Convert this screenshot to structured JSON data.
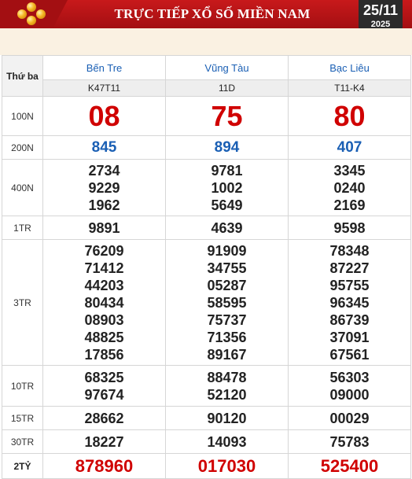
{
  "header": {
    "title": "TRỰC TIẾP XỔ SỐ MIỀN NAM",
    "date_day": "25/11",
    "date_year": "2025",
    "logo_icon": "lottery-balls-icon"
  },
  "table": {
    "weekday": "Thứ ba",
    "provinces": [
      {
        "name": "Bến Tre",
        "code": "K47T11"
      },
      {
        "name": "Vũng Tàu",
        "code": "11D"
      },
      {
        "name": "Bạc Liêu",
        "code": "T11-K4"
      }
    ],
    "prizes": [
      {
        "label": "100N",
        "values": [
          [
            "08"
          ],
          [
            "75"
          ],
          [
            "80"
          ]
        ]
      },
      {
        "label": "200N",
        "values": [
          [
            "845"
          ],
          [
            "894"
          ],
          [
            "407"
          ]
        ]
      },
      {
        "label": "400N",
        "values": [
          [
            "2734",
            "9229",
            "1962"
          ],
          [
            "9781",
            "1002",
            "5649"
          ],
          [
            "3345",
            "0240",
            "2169"
          ]
        ]
      },
      {
        "label": "1TR",
        "values": [
          [
            "9891"
          ],
          [
            "4639"
          ],
          [
            "9598"
          ]
        ]
      },
      {
        "label": "3TR",
        "values": [
          [
            "76209",
            "71412",
            "44203",
            "80434",
            "08903",
            "48825",
            "17856"
          ],
          [
            "91909",
            "34755",
            "05287",
            "58595",
            "75737",
            "71356",
            "89167"
          ],
          [
            "78348",
            "87227",
            "95755",
            "96345",
            "86739",
            "37091",
            "67561"
          ]
        ]
      },
      {
        "label": "10TR",
        "values": [
          [
            "68325",
            "97674"
          ],
          [
            "88478",
            "52120"
          ],
          [
            "56303",
            "09000"
          ]
        ]
      },
      {
        "label": "15TR",
        "values": [
          [
            "28662"
          ],
          [
            "90120"
          ],
          [
            "00029"
          ]
        ]
      },
      {
        "label": "30TR",
        "values": [
          [
            "18227"
          ],
          [
            "14093"
          ],
          [
            "75783"
          ]
        ]
      },
      {
        "label": "2TỶ",
        "values": [
          [
            "878960"
          ],
          [
            "017030"
          ],
          [
            "525400"
          ]
        ]
      }
    ]
  },
  "colors": {
    "header_red": "#c8191b",
    "number_red": "#d00000",
    "province_blue": "#1a5fb4",
    "date_box": "#2b2b2b"
  }
}
